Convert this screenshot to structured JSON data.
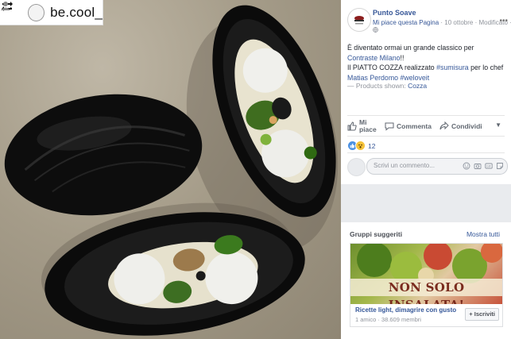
{
  "repost": {
    "username": "be.cool_"
  },
  "post": {
    "page_name": "Punto Soave",
    "like_page": "Mi piace questa Pagina",
    "date": "10 ottobre",
    "edited": "Modificato",
    "line1": "È diventato ormai un grande classico per",
    "mention1": "Contraste Milano",
    "after_mention1": "!!",
    "line3_prefix": "Il PIATTO COZZA realizzato ",
    "hashtag1": "#sumisura",
    "line3_suffix": " per lo chef",
    "mention2": "Matias Perdomo",
    "hashtag2": "#weloveit",
    "products_prefix": "— Products shown: ",
    "product": "Cozza"
  },
  "actions": {
    "like_line1": "Mi",
    "like_line2": "piace",
    "comment": "Commenta",
    "share": "Condividi"
  },
  "reactions": {
    "count": "12"
  },
  "comment_box": {
    "placeholder": "Scrivi un commento..."
  },
  "suggested_groups": {
    "title": "Gruppi suggeriti",
    "see_all": "Mostra tutti",
    "group": {
      "image_text": "NON SOLO INSALATA!",
      "name": "Ricette light, dimagrire con gusto",
      "members": "1 amico · 38.609 membri",
      "join": "+ Iscriviti"
    }
  },
  "colors": {
    "link": "#365899",
    "page_bg": "#e9ebee"
  }
}
